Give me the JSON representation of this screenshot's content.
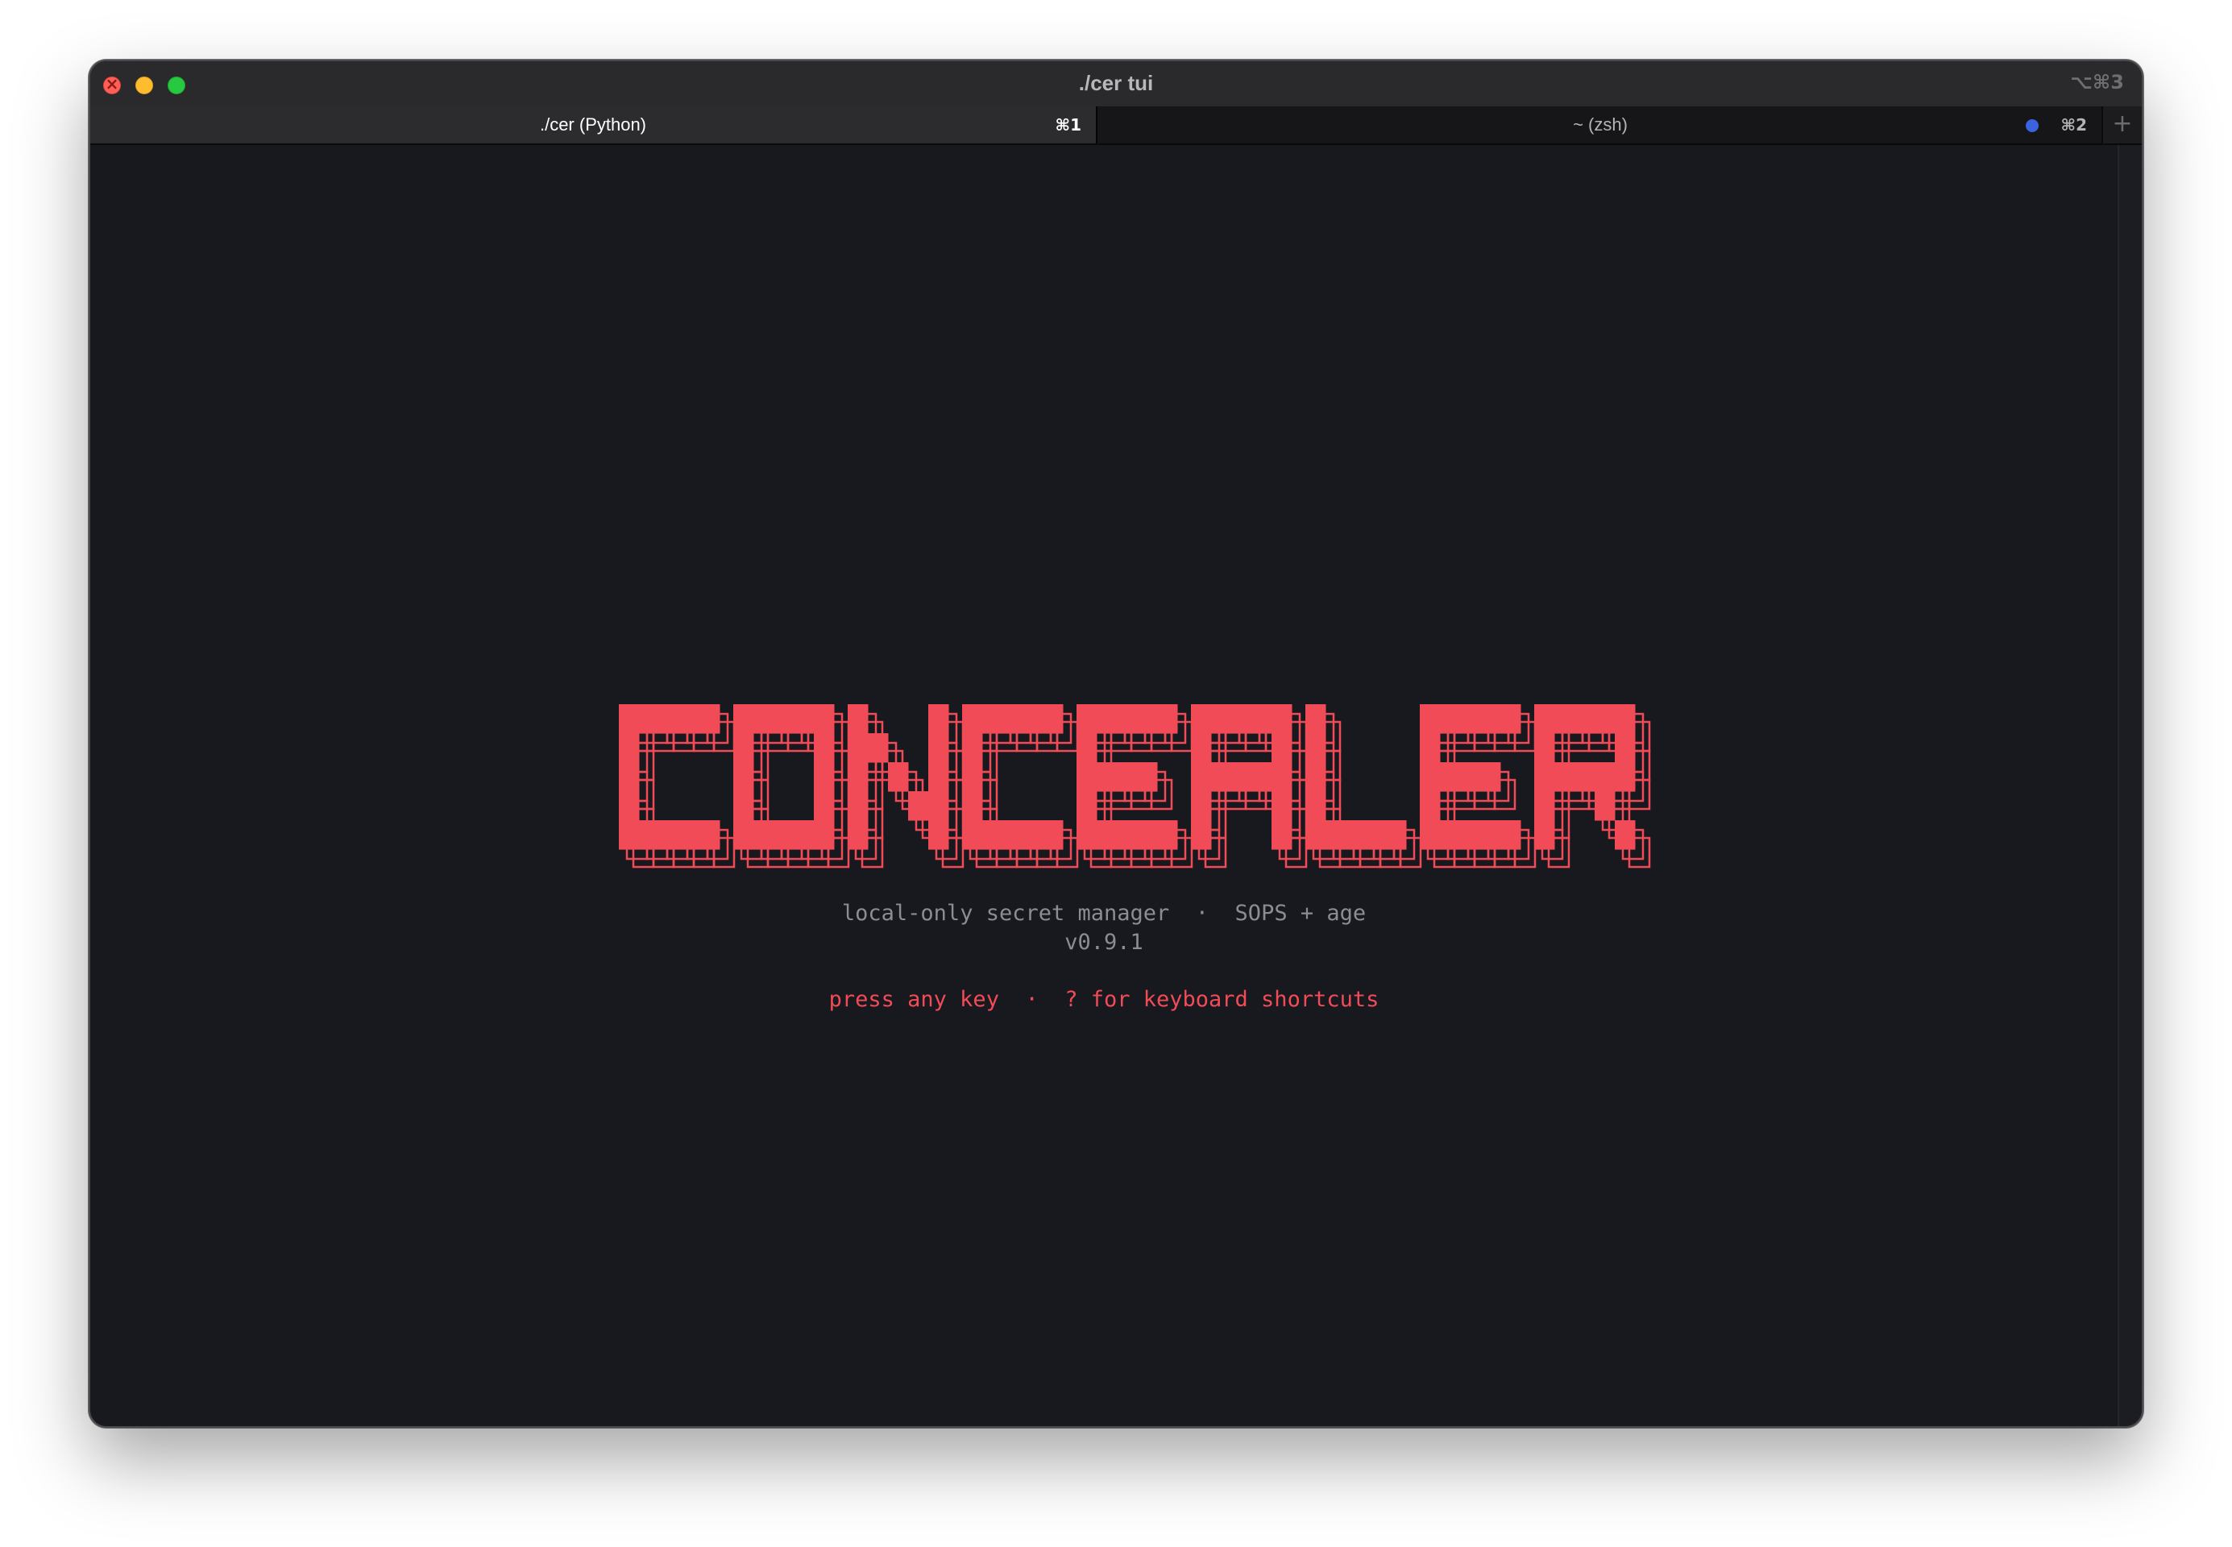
{
  "window": {
    "title": "./cer tui",
    "shortcut": "⌥⌘3"
  },
  "tabs": [
    {
      "label": "./cer (Python)",
      "shortcut": "⌘1",
      "active": true
    },
    {
      "label": "~ (zsh)",
      "shortcut": "⌘2",
      "active": false,
      "indicator_color": "#3b63e0"
    }
  ],
  "new_tab_icon": "plus-icon",
  "terminal": {
    "logo_text": "CONCEALER",
    "logo_color": "#f24b58",
    "tagline": "local-only secret manager  ·  SOPS + age",
    "version": "v0.9.1",
    "prompt": "press any key  ·  ? for keyboard shortcuts",
    "background": "#17191e"
  }
}
